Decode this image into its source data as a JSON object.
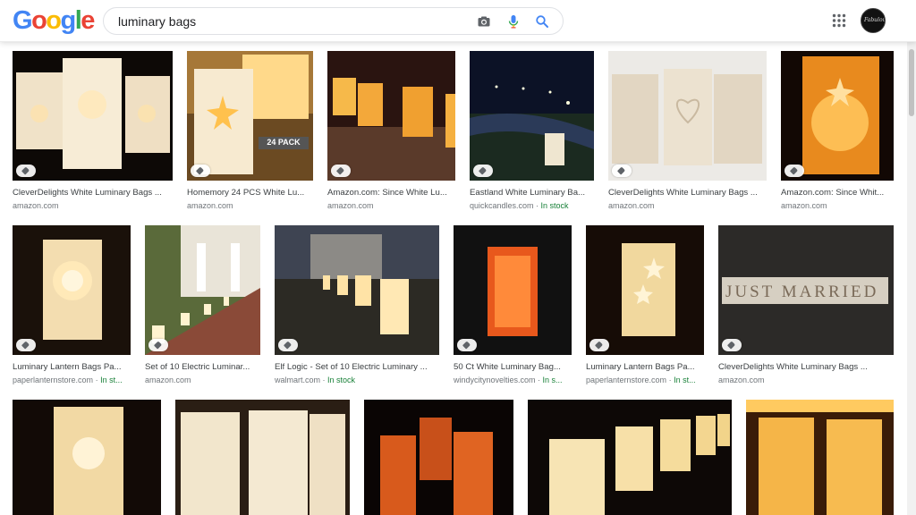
{
  "header": {
    "logo_letters": [
      "G",
      "o",
      "o",
      "g",
      "l",
      "e"
    ],
    "logo_colors": [
      "#4285f4",
      "#ea4335",
      "#fbbc05",
      "#4285f4",
      "#34a853",
      "#ea4335"
    ],
    "search_query": "luminary bags",
    "icons": [
      "camera-icon",
      "microphone-icon",
      "search-icon",
      "apps-grid-icon"
    ],
    "avatar_text": "Fabulous"
  },
  "results": [
    {
      "title": "CleverDelights White Luminary Bags ...",
      "source": "amazon.com",
      "stock": ""
    },
    {
      "title": "Homemory 24 PCS White Lu...",
      "source": "amazon.com",
      "stock": "",
      "badge": "24 PACK"
    },
    {
      "title": "Amazon.com: Since White Lu...",
      "source": "amazon.com",
      "stock": ""
    },
    {
      "title": "Eastland White Luminary Ba...",
      "source": "quickcandles.com",
      "stock": "In stock"
    },
    {
      "title": "CleverDelights White Luminary Bags ...",
      "source": "amazon.com",
      "stock": ""
    },
    {
      "title": "Amazon.com: Since Whit...",
      "source": "amazon.com",
      "stock": ""
    },
    {
      "title": "Luminary Lantern Bags Pa...",
      "source": "paperlanternstore.com",
      "stock": "In st..."
    },
    {
      "title": "Set of 10 Electric Luminar...",
      "source": "amazon.com",
      "stock": ""
    },
    {
      "title": "Elf Logic - Set of 10 Electric Luminary ...",
      "source": "walmart.com",
      "stock": "In stock"
    },
    {
      "title": "50 Ct White Luminary Bag...",
      "source": "windycitynovelties.com",
      "stock": "In s..."
    },
    {
      "title": "Luminary Lantern Bags Pa...",
      "source": "paperlanternstore.com",
      "stock": "In st..."
    },
    {
      "title": "CleverDelights White Luminary Bags ...",
      "source": "amazon.com",
      "stock": ""
    },
    {
      "title": "",
      "source": "",
      "stock": ""
    },
    {
      "title": "",
      "source": "",
      "stock": ""
    },
    {
      "title": "",
      "source": "",
      "stock": ""
    },
    {
      "title": "",
      "source": "",
      "stock": ""
    },
    {
      "title": "",
      "source": "",
      "stock": ""
    }
  ],
  "colors": {
    "stock_green": "#188038",
    "source_gray": "#70757a"
  }
}
